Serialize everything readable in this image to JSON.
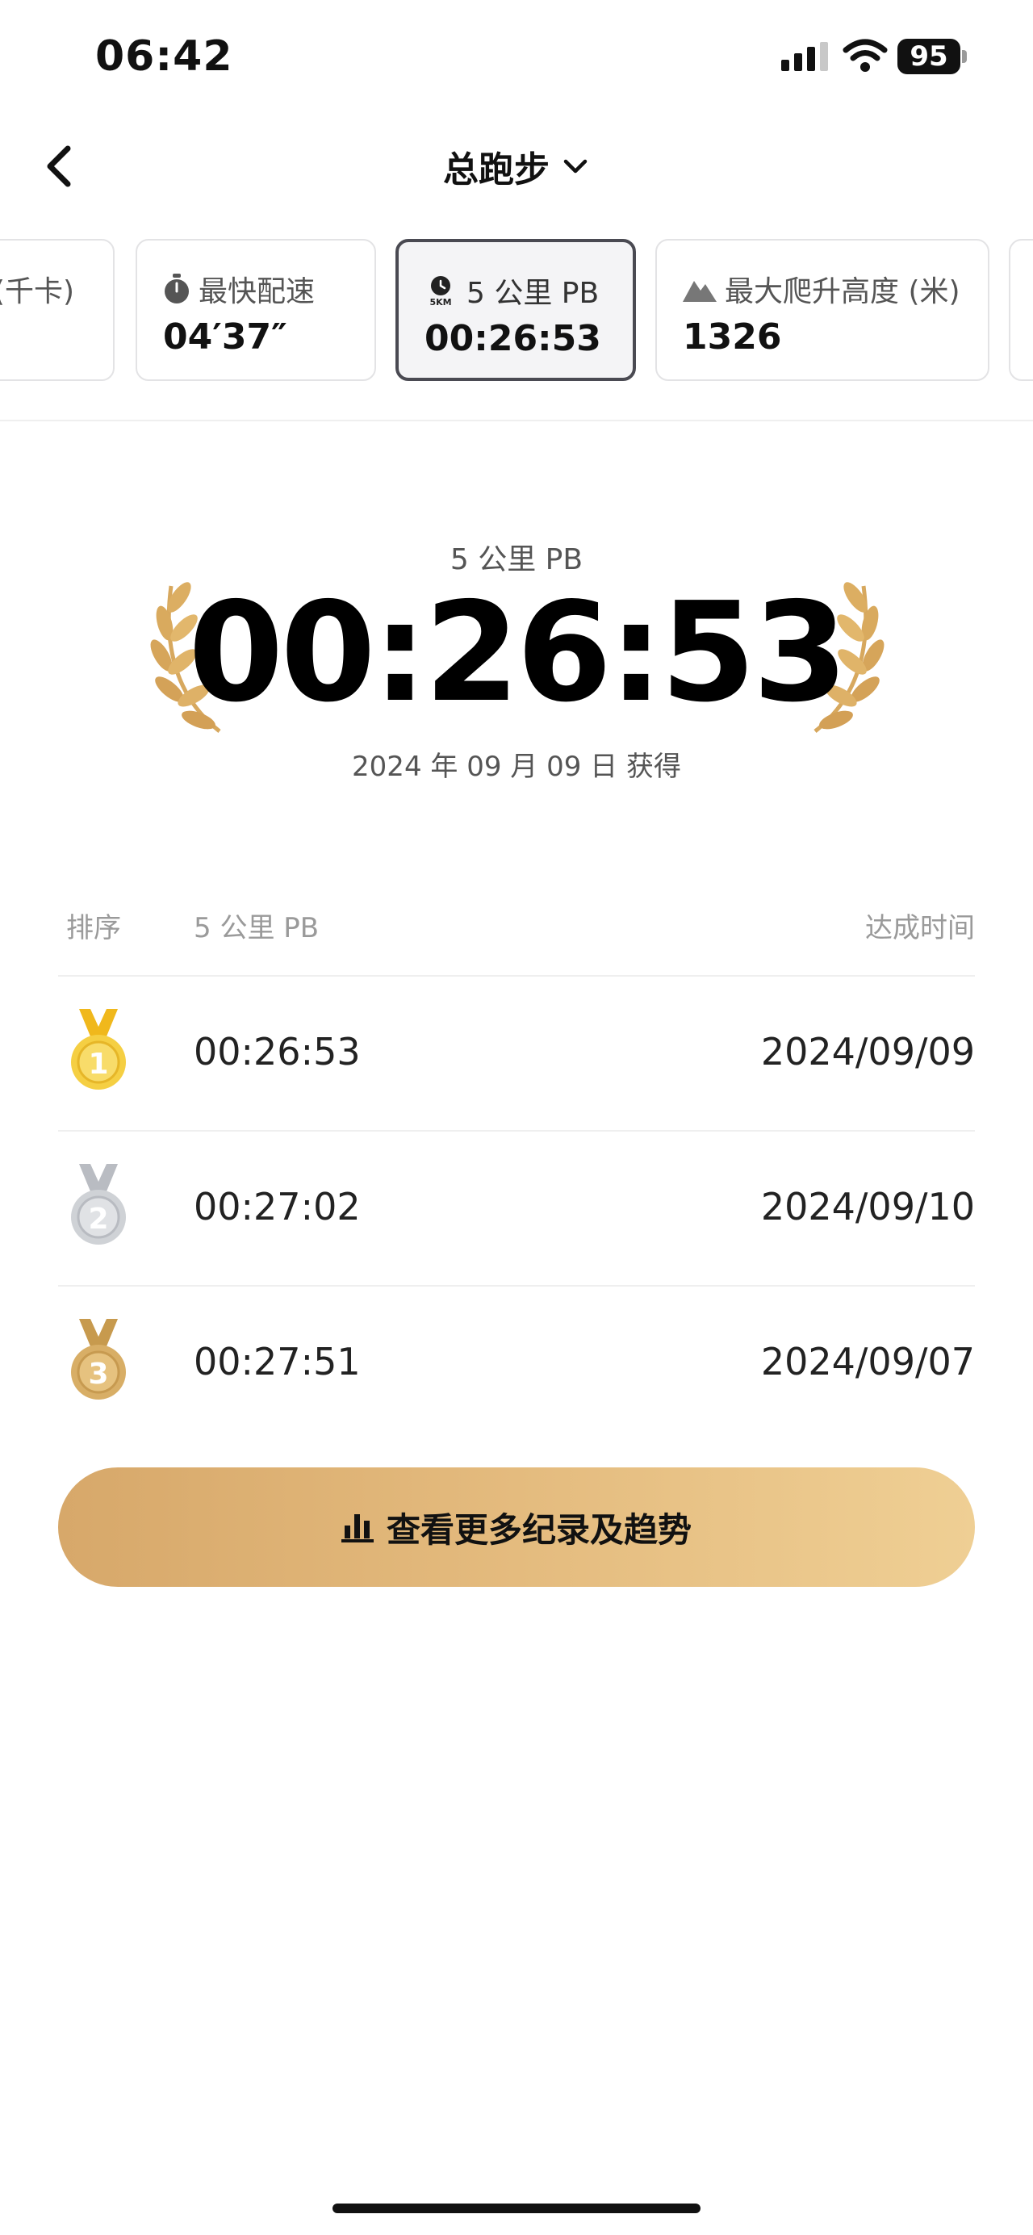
{
  "status_bar": {
    "time": "06:42",
    "battery": "95"
  },
  "nav": {
    "title": "总跑步"
  },
  "cards": [
    {
      "label": "(千卡)",
      "value": "",
      "icon": "none"
    },
    {
      "label": "最快配速",
      "value": "04′37″",
      "icon": "stopwatch-icon"
    },
    {
      "label": "5 公里 PB",
      "value": "00:26:53",
      "icon": "5km-icon",
      "icon_text": "5KM"
    },
    {
      "label": "最大爬升高度 (米)",
      "value": "1326",
      "icon": "mountain-icon"
    }
  ],
  "hero": {
    "label": "5 公里 PB",
    "time": "00:26:53",
    "date": "2024 年 09 月 09 日 获得"
  },
  "table": {
    "headers": {
      "rank": "排序",
      "metric": "5 公里 PB",
      "date": "达成时间"
    },
    "rows": [
      {
        "rank": "1",
        "time": "00:26:53",
        "date": "2024/09/09",
        "medal": "gold"
      },
      {
        "rank": "2",
        "time": "00:27:02",
        "date": "2024/09/10",
        "medal": "silver"
      },
      {
        "rank": "3",
        "time": "00:27:51",
        "date": "2024/09/07",
        "medal": "bronze"
      }
    ]
  },
  "button": {
    "label": "查看更多纪录及趋势"
  },
  "colors": {
    "gold": "#f2c232",
    "silver": "#c6c9ce",
    "bronze": "#d2a65c",
    "button_start": "#d7a86a",
    "button_end": "#efcf94"
  }
}
